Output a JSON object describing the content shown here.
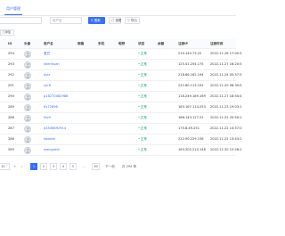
{
  "header": {
    "tab_label": "用户管理"
  },
  "filters": {
    "username_placeholder": "",
    "phone_placeholder": "用户名",
    "search_label": "搜索",
    "reset_label": "重置",
    "export_label": "导出"
  },
  "toolbar": {
    "add_label": "添加"
  },
  "table": {
    "columns": {
      "id": "ID",
      "avatar": "头像",
      "username": "用户名",
      "email": "邮箱",
      "phone": "手机",
      "nickname": "昵称",
      "status": "状态",
      "cash": "余额",
      "register_ip": "注册IP",
      "register_time": "注册时间"
    },
    "rows": [
      {
        "id": "294",
        "username": "爱豆",
        "status": "正常",
        "register_ip": "219.140.73.22",
        "register_time": "2022.11.26 17:00:5"
      },
      {
        "id": "293",
        "username": "shenhuan",
        "status": "正常",
        "register_ip": "125.41.254.175",
        "register_time": "2022.11.27 16:20:5"
      },
      {
        "id": "292",
        "username": "dylz",
        "status": "正常",
        "register_ip": "218.66.162.194",
        "register_time": "2022.11.24 05:57:5"
      },
      {
        "id": "291",
        "username": "xyr6",
        "status": "正常",
        "register_ip": "222.80.113.192",
        "register_time": "2022.11.20 06:39:5"
      },
      {
        "id": "290",
        "username": "g18270082988",
        "status": "正常",
        "register_ip": "118.249.189.169",
        "register_time": "2022.11.27 18:54:4"
      },
      {
        "id": "289",
        "username": "fly72896",
        "status": "正常",
        "register_ip": "183.167.114.253",
        "register_time": "2022.11.23 19:03:1"
      },
      {
        "id": "288",
        "username": "fdvrl",
        "status": "正常",
        "register_ip": "188.143.127.22",
        "register_time": "2022.11.22 20:50:1"
      },
      {
        "id": "287",
        "username": "q3536692914",
        "status": "正常",
        "register_ip": "175.8.49.251",
        "register_time": "2022.11.22 14:57:0"
      },
      {
        "id": "286",
        "username": "tweeze",
        "status": "正常",
        "register_ip": "222.90.229.156",
        "register_time": "2022.11.22 13:43:2"
      },
      {
        "id": "285",
        "username": "wangwenl",
        "status": "正常",
        "register_ip": "183.202.210.148",
        "register_time": "2022.11.20 12:28:2"
      }
    ]
  },
  "pagination": {
    "page_size": "10",
    "first": "«",
    "prev": "‹",
    "pages": [
      "1",
      "2",
      "3",
      "4",
      "5"
    ],
    "ellipsis": "...",
    "last_page": "30",
    "next": "下一页",
    "total": "共 294 条"
  }
}
